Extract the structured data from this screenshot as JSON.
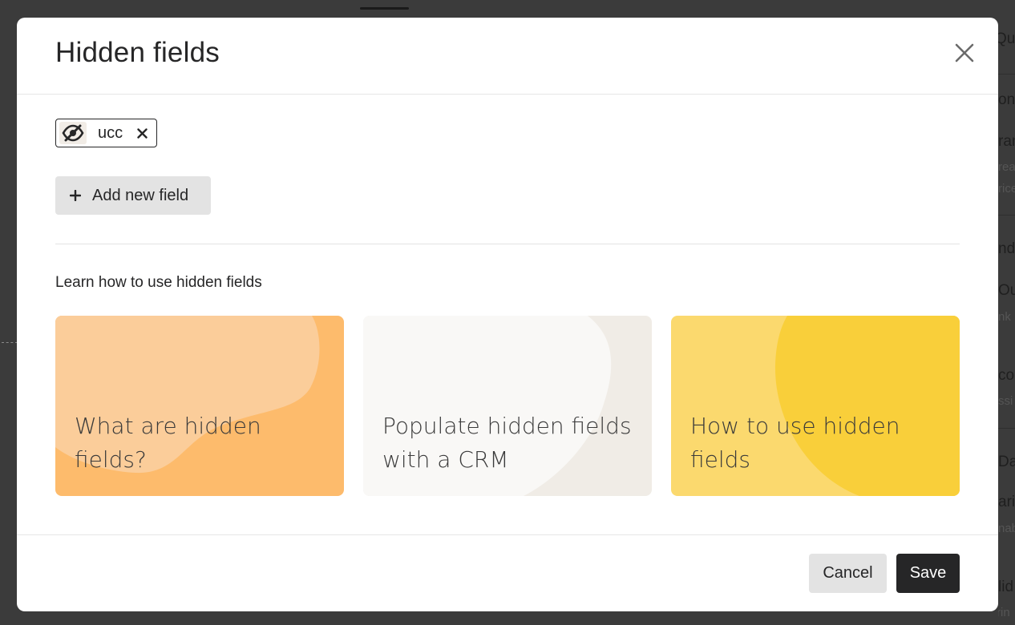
{
  "background": {
    "right_panel_fragments": [
      "Que",
      "on",
      "ran",
      "rea",
      "rice",
      "nd",
      "Out",
      "nk",
      "co",
      "ssi",
      "Dat",
      "ari",
      "nab",
      "lid",
      "Brin"
    ]
  },
  "modal": {
    "title": "Hidden fields",
    "close_icon": "close-icon",
    "fields": [
      {
        "label": "ucc",
        "icon": "eye-slash-icon",
        "remove_icon": "x-icon"
      }
    ],
    "add_button_label": "Add new field",
    "add_button_icon": "plus-icon",
    "learn_title": "Learn how to use hidden fields",
    "cards": [
      {
        "text": "What are hidden fields?",
        "color": "#fdbb6c"
      },
      {
        "text": "Populate hidden fields with a CRM",
        "color": "#f0ece6"
      },
      {
        "text": "How to use hidden fields",
        "color": "#fbd96e"
      }
    ],
    "cancel_label": "Cancel",
    "save_label": "Save"
  },
  "colors": {
    "overlay": "#3b3b3b",
    "primary_button": "#262627",
    "secondary_button": "#e3e3e3"
  }
}
